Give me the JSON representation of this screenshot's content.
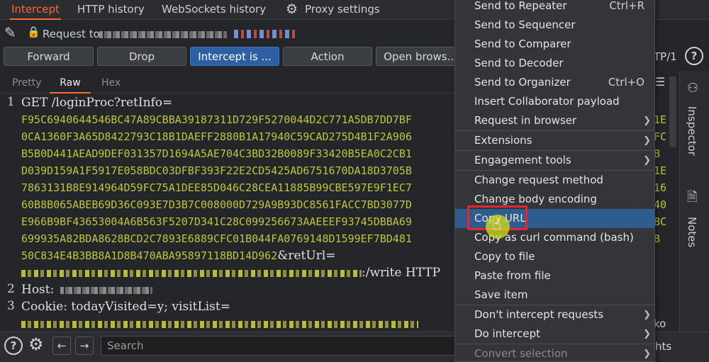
{
  "tabs": [
    {
      "label": "Intercept",
      "active": true
    },
    {
      "label": "HTTP history"
    },
    {
      "label": "WebSockets history"
    },
    {
      "label": "Proxy settings"
    }
  ],
  "request_row": {
    "label": "Request to"
  },
  "toolbar": {
    "forward": "Forward",
    "drop": "Drop",
    "intercept": "Intercept is ...",
    "action": "Action",
    "open_browser": "Open brows...",
    "http_version": "TP/1"
  },
  "editor_tabs": [
    {
      "label": "Pretty"
    },
    {
      "label": "Raw",
      "active": true
    },
    {
      "label": "Hex"
    }
  ],
  "editor": {
    "line1_prefix": "GET /loginProc?retInfo=",
    "hex_lines": [
      "F95C6940644546BC47A89CBBA39187311D729F5270044D2C771A5DB7DD7BF",
      "0CA1360F3A65D8422793C18B1DAEFF2880B1A17940C59CAD275D4B1F2A906",
      "B5B0D441AEAD9DEF031357D1694A5AE704C3BD32B0089F33420B5EA0C2CB1",
      "D039D159A1F5917E058BDC03DFBF393F22E2CD5425AD6751670DA18D3705B",
      "7863131B8E914964D59FC75A1DEE85D046C28CEA11885B99CBE597E9F1EC7",
      "60B8B065ABEB69D36C093E7D3B7C008000D729A9B93DC8561FACC7BD3077D",
      "E966B9BF43653004A6B563F5207D341C28C099256673AAEEEF93745DBBA69",
      "699935A82BDA8628BCD2C7893E6889CFC01B044FA0769148D1599EF7BD481"
    ],
    "last_hex": "50C834E4B3BB8A1D8B470ABA95897118BD14D962",
    "reurl_text": "&retUrl=",
    "write_text": ":/write HTTP",
    "line2_key": "Host:",
    "line3_prefix": "Cookie: todayVisited=y; visitList=",
    "right_fragments": [
      "1E",
      "FC",
      "B",
      "1E",
      "16",
      "40",
      "BC",
      "B"
    ],
    "ko_fragment": "ko",
    "hts_fragment": "hts"
  },
  "bottom": {
    "search_placeholder": "Search"
  },
  "inspector": {
    "inspector_label": "Inspector",
    "notes_label": "Notes"
  },
  "context_menu": {
    "items": [
      {
        "label": "Send to Repeater",
        "shortcut": "Ctrl+R"
      },
      {
        "label": "Send to Sequencer"
      },
      {
        "label": "Send to Comparer"
      },
      {
        "label": "Send to Decoder"
      },
      {
        "label": "Send to Organizer",
        "shortcut": "Ctrl+O"
      },
      {
        "label": "Insert Collaborator payload"
      },
      {
        "label": "Request in browser",
        "submenu": true
      },
      {
        "label": "Extensions",
        "submenu": true
      },
      {
        "label": "Engagement tools",
        "submenu": true
      },
      {
        "label": "Change request method"
      },
      {
        "label": "Change body encoding"
      },
      {
        "label": "Copy URL",
        "highlighted": true
      },
      {
        "label": "Copy as curl command (bash)"
      },
      {
        "label": "Copy to file"
      },
      {
        "label": "Paste from file"
      },
      {
        "label": "Save item"
      },
      {
        "label": "Don't intercept requests",
        "submenu": true
      },
      {
        "label": "Do intercept",
        "submenu": true
      },
      {
        "label": "Convert selection",
        "submenu": true,
        "disabled": true
      }
    ]
  },
  "colors": {
    "accent": "#ff6a2b",
    "highlight": "#2e5c8f",
    "annotation": "#e8262a",
    "hex_text": "#c0c43a"
  }
}
